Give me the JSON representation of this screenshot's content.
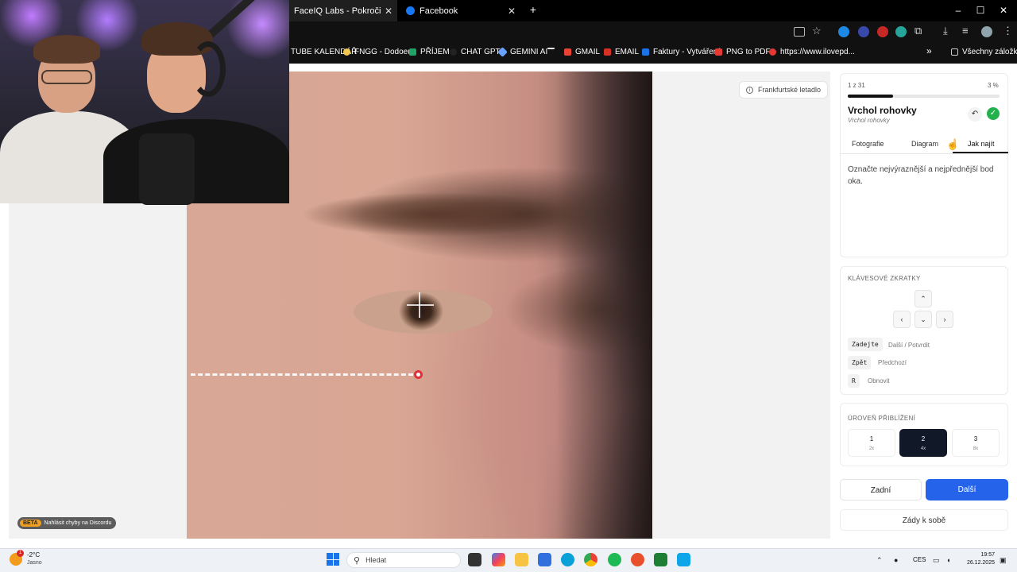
{
  "browser": {
    "tabs": [
      {
        "label": "FaceIQ Labs - Pokročilá analýza",
        "active": true
      },
      {
        "label": "Facebook",
        "active": false
      }
    ],
    "new_tab": "+",
    "window_controls": {
      "minimize": "–",
      "maximize": "☐",
      "close": "✕"
    },
    "bookmarks": [
      {
        "label": "TUBE KALENDÁŘ",
        "icon": "calendar-icon",
        "color": "#111111"
      },
      {
        "label": "FNGG - Dodoeu",
        "icon": "fngg-icon",
        "color": "#f2c94c"
      },
      {
        "label": "PŘÍJEM",
        "icon": "sheet-icon",
        "color": "#21a366"
      },
      {
        "label": "CHAT GPT",
        "icon": "openai-icon",
        "color": "#222222"
      },
      {
        "label": "GEMINI AI",
        "icon": "gemini-icon",
        "color": "#6aa1ff"
      },
      {
        "label": "",
        "icon": "dash-icon",
        "color": "#ffffff"
      },
      {
        "label": "GMAIL",
        "icon": "gmail-icon",
        "color": "#ea4335"
      },
      {
        "label": "EMAIL",
        "icon": "email-icon",
        "color": "#d93025"
      },
      {
        "label": "Faktury - Vytváření",
        "icon": "invoice-icon",
        "color": "#1a73e8"
      },
      {
        "label": "PNG to PDF",
        "icon": "heart-icon",
        "color": "#e53935"
      },
      {
        "label": "https://www.ilovepd...",
        "icon": "ilovepdf-icon",
        "color": "#e53935"
      }
    ],
    "bookmarks_overflow": "»",
    "all_bookmarks": "Všechny záložky"
  },
  "main": {
    "landmark_chip": "Frankfurtské letadlo",
    "beta_tag": "BETA",
    "beta_text": "Nahlásit chyby na Discordu"
  },
  "panel": {
    "progress_text": "1 z 31",
    "progress_percent": "3 %",
    "progress_value": 0.03,
    "title": "Vrchol rohovky",
    "subtitle": "Vrchol rohovky",
    "undo_symbol": "↶",
    "ok_symbol": "✓",
    "tabs": [
      "Fotografie",
      "Diagram",
      "Jak najít"
    ],
    "active_tab": "Jak najít",
    "instruction": "Označte nejvýraznější a nejpřednější bod oka.",
    "shortcuts_heading": "KLÁVESOVÉ ZKRATKY",
    "arrows": {
      "up": "⌃",
      "left": "‹",
      "down": "⌄",
      "right": "›"
    },
    "shortcuts": [
      {
        "key": "Zadejte",
        "desc": "Další / Potvrdit"
      },
      {
        "key": "Zpět",
        "desc": "Předchozí"
      },
      {
        "key": "R",
        "desc": "Obnovit"
      }
    ],
    "zoom_heading": "ÚROVEŇ PŘIBLÍŽENÍ",
    "zoom_levels": [
      {
        "num": "1",
        "mult": "2x",
        "active": false
      },
      {
        "num": "2",
        "mult": "4x",
        "active": true
      },
      {
        "num": "3",
        "mult": "8x",
        "active": false
      }
    ],
    "back_label": "Zadní",
    "next_label": "Další",
    "backwards_label": "Zády k sobě"
  },
  "taskbar": {
    "temperature": "-2°C",
    "condition": "Jasno",
    "weather_badge": "1",
    "search_placeholder": "Hledat",
    "language": "CES",
    "time": "19:57",
    "date": "26.12.2025"
  },
  "colors": {
    "accent": "#2563eb",
    "dark": "#111827",
    "success": "#22b14c"
  }
}
